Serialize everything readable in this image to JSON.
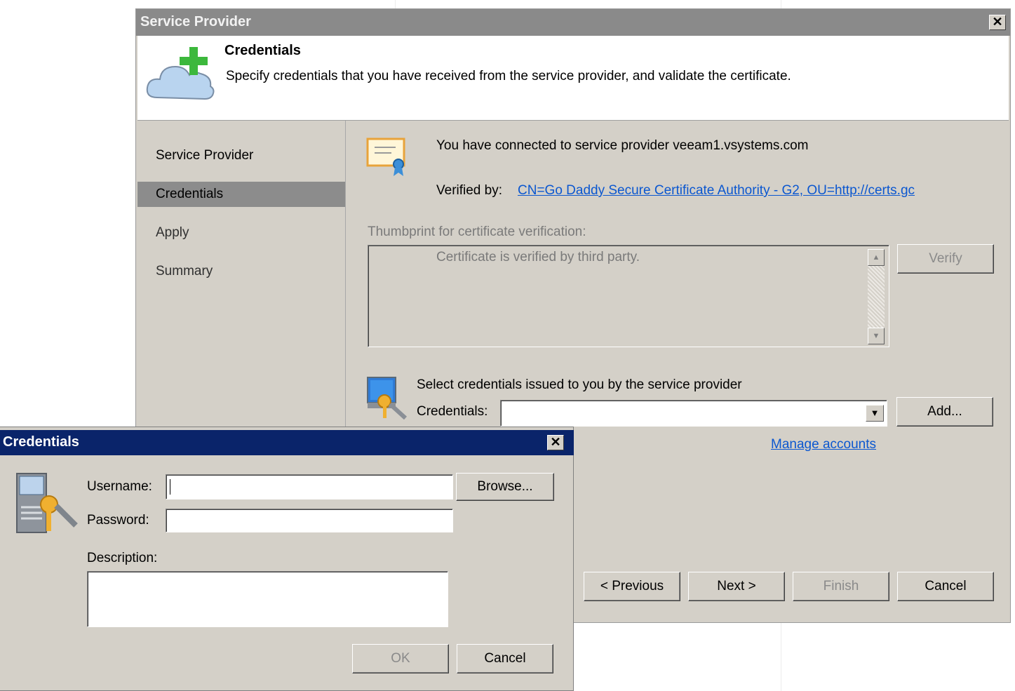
{
  "main_window": {
    "title": "Service Provider",
    "close_glyph": "✕",
    "header": {
      "title": "Credentials",
      "description": "Specify credentials that you have received from the service provider, and validate the certificate."
    },
    "nav": [
      {
        "label": "Service Provider"
      },
      {
        "label": "Credentials"
      },
      {
        "label": "Apply"
      },
      {
        "label": "Summary"
      }
    ],
    "connection": {
      "message": "You have connected to service provider veeam1.vsystems.com",
      "verified_label": "Verified by:",
      "verified_link": "CN=Go Daddy Secure Certificate Authority - G2, OU=http://certs.gc"
    },
    "thumbprint": {
      "label": "Thumbprint for certificate verification:",
      "value": "Certificate is verified by third party.",
      "verify_label": "Verify"
    },
    "credentials": {
      "prompt": "Select credentials issued to you by the service provider",
      "label": "Credentials:",
      "value": "",
      "add_label": "Add...",
      "manage_link": "Manage accounts"
    },
    "footer": {
      "previous_label": "< Previous",
      "next_label": "Next >",
      "finish_label": "Finish",
      "cancel_label": "Cancel"
    }
  },
  "cred_dialog": {
    "title": "Credentials",
    "close_glyph": "✕",
    "username_label": "Username:",
    "username_value": "",
    "browse_label": "Browse...",
    "password_label": "Password:",
    "password_value": "",
    "description_label": "Description:",
    "description_value": "",
    "ok_label": "OK",
    "cancel_label": "Cancel"
  },
  "icons": {
    "cloud_add": "cloud-plus-icon",
    "certificate": "certificate-icon",
    "credentials_key": "computer-key-icon",
    "dropdown_arrow": "▼",
    "scroll_up": "▲",
    "scroll_down": "▼"
  },
  "colors": {
    "title_bar_inactive": "#8a8a8a",
    "title_bar_active": "#0a246a",
    "nav_selected": "#8c8c8c",
    "link": "#0b57d0",
    "cloud_plus_green": "#3cb83c"
  }
}
